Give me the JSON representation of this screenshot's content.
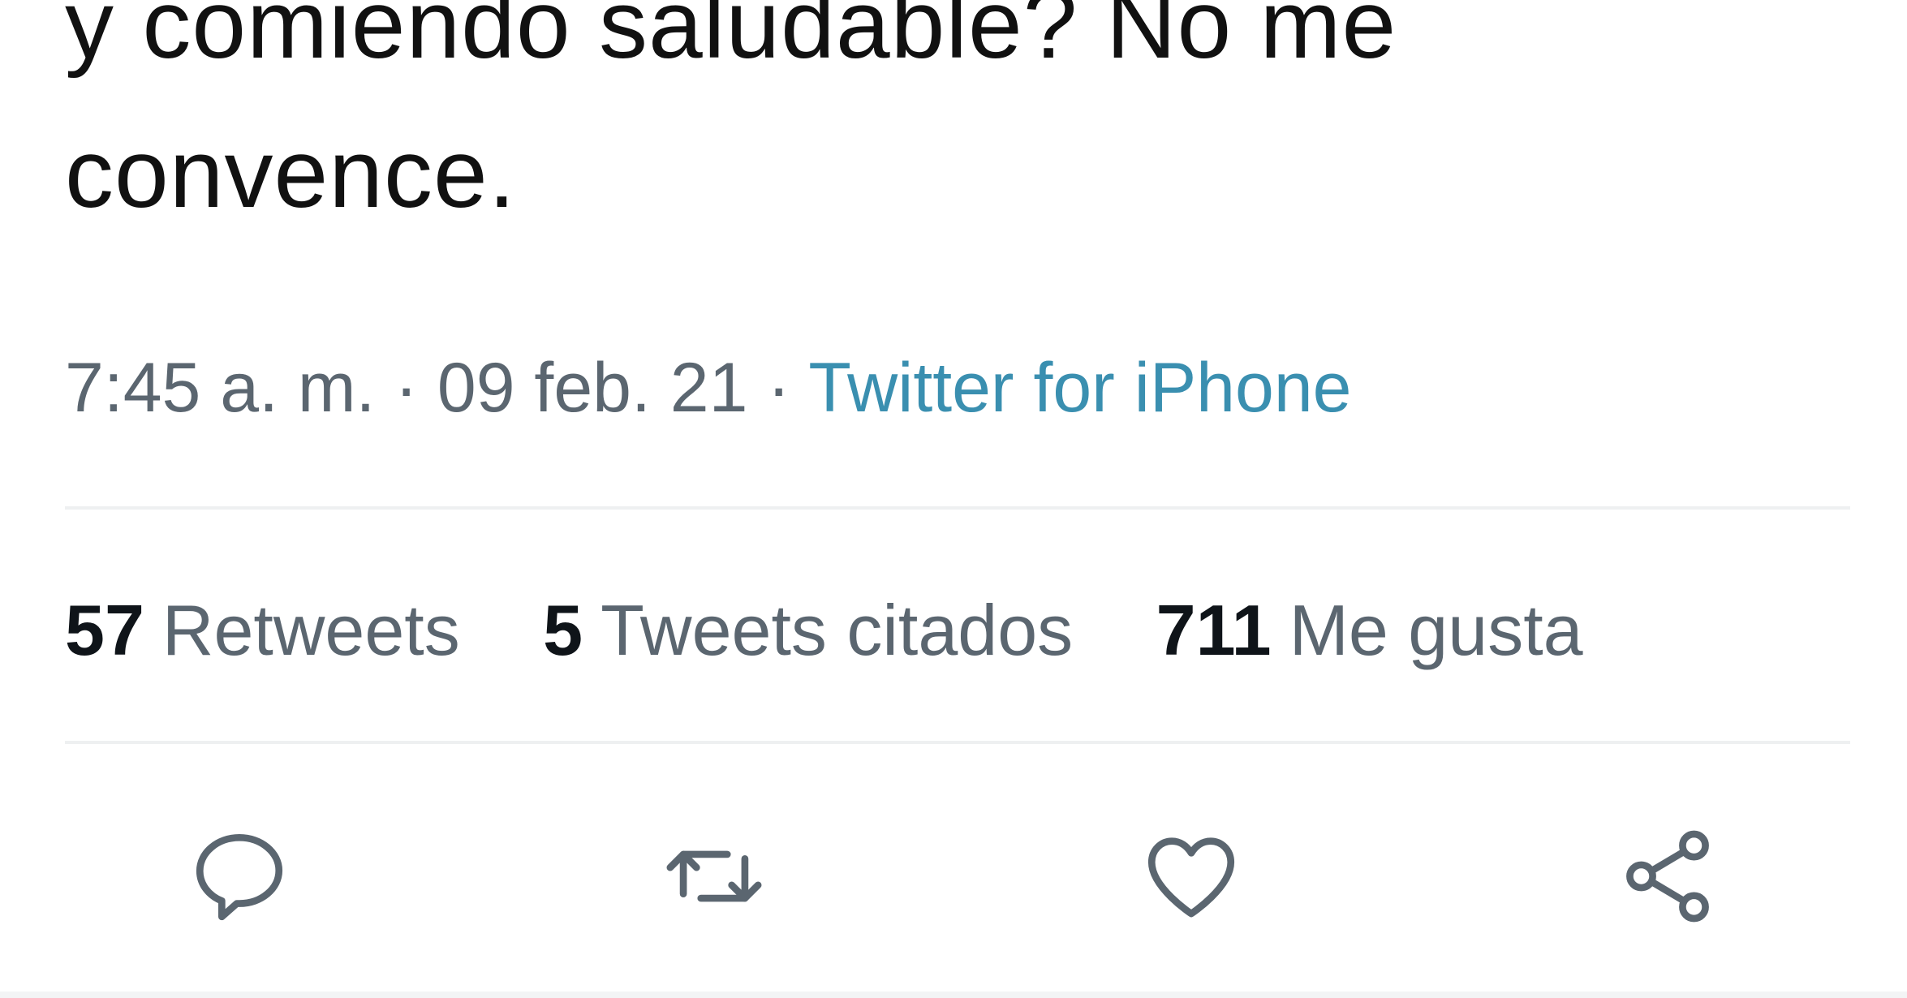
{
  "tweet": {
    "text_lines": [
      "y comiendo saludable? No me",
      "convence."
    ],
    "time": "7:45 a. m.",
    "separator": " · ",
    "date": "09 feb. 21",
    "source": "Twitter for iPhone"
  },
  "stats": [
    {
      "count": "57",
      "label": "Retweets"
    },
    {
      "count": "5",
      "label": "Tweets citados"
    },
    {
      "count": "711",
      "label": "Me gusta"
    }
  ],
  "actions": [
    {
      "name": "reply",
      "icon": "reply-icon"
    },
    {
      "name": "retweet",
      "icon": "retweet-icon"
    },
    {
      "name": "like",
      "icon": "heart-icon"
    },
    {
      "name": "share",
      "icon": "share-icon"
    }
  ],
  "colors": {
    "text": "#111111",
    "muted": "#5b6670",
    "link": "#3a8fb0",
    "divider": "#eef0f1",
    "icon": "#5b6670"
  }
}
